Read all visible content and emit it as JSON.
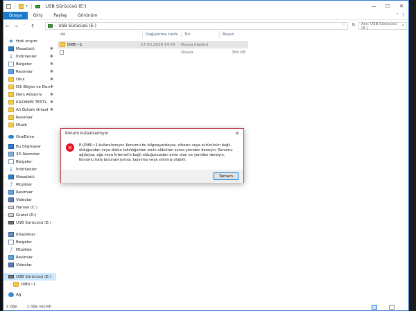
{
  "window": {
    "title": "USB Sürücüsü (E:)",
    "minimize": "—",
    "maximize": "☐",
    "close": "✕"
  },
  "ribbon": {
    "tabs": [
      "Dosya",
      "Giriş",
      "Paylaş",
      "Görünüm"
    ],
    "collapse": "˅",
    "help": "?"
  },
  "address": {
    "back": "←",
    "forward": "→",
    "recent": "˅",
    "up": "↑",
    "arrow": "›",
    "path": "USB Sürücüsü (E:)",
    "dropdown": "˅",
    "refresh": "↻",
    "search_placeholder": "Ara: USB Sürücüsü (E:)"
  },
  "nav": {
    "quick_access": "Hızlı erişim",
    "quick_items": [
      {
        "label": "Masaüstü",
        "icon": "desktop-icon",
        "pinned": "✱"
      },
      {
        "label": "İndirilenler",
        "icon": "downloads-icon",
        "pinned": "✱"
      },
      {
        "label": "Belgeler",
        "icon": "documents-icon",
        "pinned": "✱"
      },
      {
        "label": "Resimler",
        "icon": "pictures-icon",
        "pinned": "✱"
      },
      {
        "label": "Okul",
        "icon": "folder-icon",
        "pinned": "✱"
      },
      {
        "label": "Dili Bilgisi ve Den",
        "icon": "folder-icon",
        "pinned": "✱"
      },
      {
        "label": "Ders Anlatımı",
        "icon": "folder-icon",
        "pinned": "✱"
      },
      {
        "label": "KAZANIM TESTL",
        "icon": "folder-icon",
        "pinned": "✱"
      },
      {
        "label": "Ali Öztürk Ortaol",
        "icon": "folder-icon",
        "pinned": "✱"
      },
      {
        "label": "Resimler",
        "icon": "folder-icon",
        "pinned": ""
      },
      {
        "label": "Müzik",
        "icon": "folder-icon",
        "pinned": ""
      }
    ],
    "onedrive": "OneDrive",
    "this_pc": "Bu bilgisayar",
    "pc_items": [
      "3D Nesneler",
      "Belgeler",
      "İndirilenler",
      "Masaüstü",
      "Müzikler",
      "Resimler",
      "Videolar",
      "Hansel (C:)",
      "Gratel (D:)",
      "USB Sürücüsü (E:)"
    ],
    "libraries": "Kitaplıklar",
    "lib_items": [
      "Belgeler",
      "Müzikler",
      "Resimler",
      "Videolar"
    ],
    "usb_drive": "USB Sürücüsü (E:)",
    "usb_child": "DIBI\\~1",
    "network": "Ağ"
  },
  "files": {
    "columns": [
      "Ad",
      "Değiştirme tarihi",
      "Tür",
      "Boyut"
    ],
    "rows": [
      {
        "name": "DIBI\\~1",
        "date": "17.03.2018 14:43",
        "type": "Dosya klasörü",
        "size": ""
      },
      {
        "name": "",
        "date": "",
        "type": "Dosya",
        "size": "384 KB"
      }
    ]
  },
  "status": {
    "count": "2 öğe",
    "selected": "1 öğe seçildi"
  },
  "dialog": {
    "title": "Konum kullanılamıyor",
    "close": "✕",
    "icon": "✕",
    "message": "E:\\DIBI\\~1 kullanılamıyor. Konumu bu bilgisayardaysa, cihazın veya sürücünün bağlı olduğundan veya diskin takıldığından emin olduktan sonra yeniden deneyin. Konumu ağdaysa, ağa veya İnternet'e bağlı olduğunuzdan emin olun ve yeniden deneyin. Konumu hala bulunamıyorsa, taşınmış veya silinmiş olabilir.",
    "ok": "Tamam"
  }
}
